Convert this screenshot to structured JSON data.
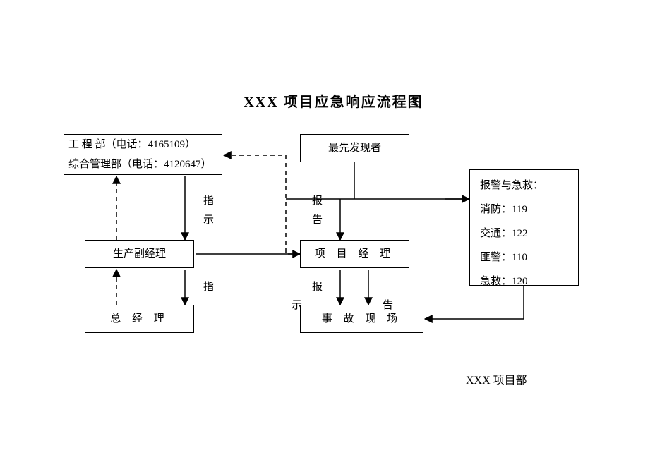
{
  "title": "XXX 项目应急响应流程图",
  "boxes": {
    "dept_line1": "工 程  部（电话：4165109）",
    "dept_line2": "综合管理部（电话：4120647）",
    "discoverer": "最先发现者",
    "alarm_title": "报警与急救：",
    "alarm_fire": "消防：119",
    "alarm_traffic": "交通：122",
    "alarm_police": "匪警：110",
    "alarm_aid": "急救：120",
    "project_manager": "项 目 经 理",
    "vice": "生产副经理",
    "gm": "总 经 理",
    "scene": "事 故 现 场"
  },
  "labels": {
    "instruct1_a": "指",
    "instruct1_b": "示",
    "report1_a": "报",
    "report1_b": "告",
    "instruct2": "指",
    "report2": "报",
    "instruct3": "示",
    "report3": "告"
  },
  "footer": "XXX 项目部"
}
